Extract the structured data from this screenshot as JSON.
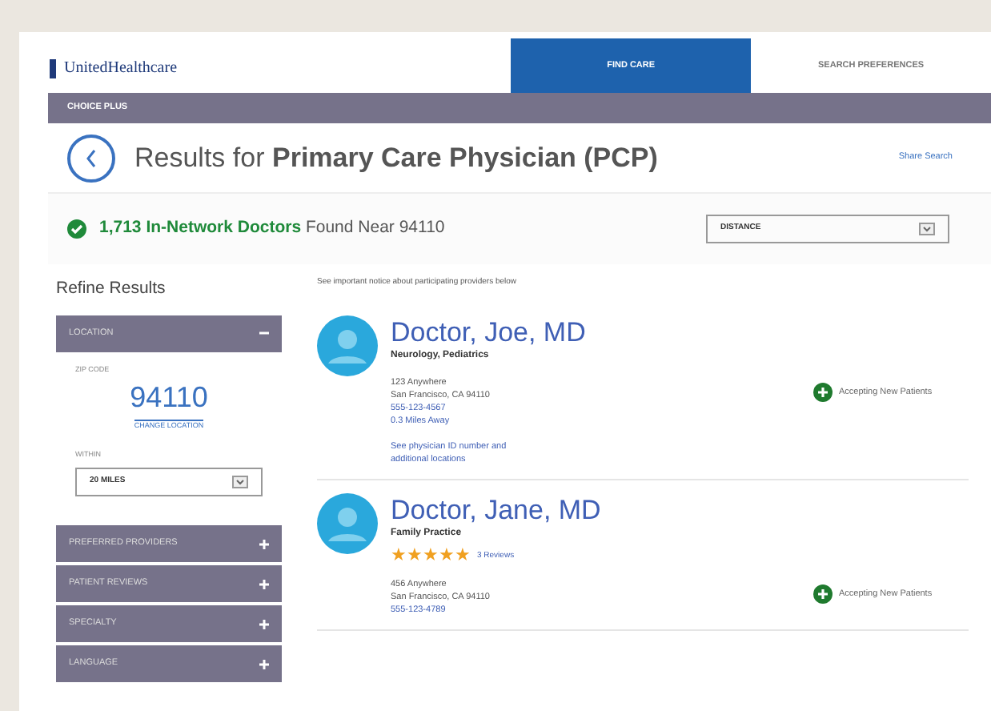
{
  "header": {
    "logo": "UnitedHealthcare",
    "tabs": [
      {
        "label": "FIND CARE",
        "selected": true
      },
      {
        "label": "SEARCH PREFERENCES",
        "selected": false
      }
    ]
  },
  "plan_bar": {
    "label": "CHOICE PLUS"
  },
  "results": {
    "prefix": "Results for ",
    "query": "Primary Care Physician (PCP)",
    "share": "Share Search"
  },
  "summary": {
    "count": "1,713 In-Network Doctors",
    "rest": " Found Near 94110",
    "sort": "DISTANCE"
  },
  "sidebar": {
    "title": "Refine Results",
    "sections": [
      {
        "label": "LOCATION",
        "expanded": true,
        "zip_label": "ZIP CODE",
        "zip": "94110",
        "change": "CHANGE LOCATION",
        "within_label": "WITHIN",
        "within": "20 MILES"
      },
      {
        "label": "PREFERRED PROVIDERS",
        "expanded": false
      },
      {
        "label": "PATIENT REVIEWS",
        "expanded": false
      },
      {
        "label": "SPECIALTY",
        "expanded": false
      },
      {
        "label": "LANGUAGE",
        "expanded": false
      }
    ]
  },
  "notice": "See important notice about participating providers below",
  "doctors": [
    {
      "name": "Doctor, Joe, MD",
      "specialty": "Neurology, Pediatrics",
      "address": [
        "123 Anywhere",
        "San Francisco, CA 94110"
      ],
      "phone": "555-123-4567",
      "distance": "0.3 Miles Away",
      "link": [
        "See physician ID number and",
        "additional locations"
      ],
      "status": "Accepting New Patients"
    },
    {
      "name": "Doctor, Jane, MD",
      "specialty": "Family Practice",
      "stars": 5,
      "reviews": "3 Reviews",
      "address": [
        "456 Anywhere",
        "San Francisco, CA 94110"
      ],
      "phone": "555-123-4789",
      "status": "Accepting New Patients"
    }
  ]
}
